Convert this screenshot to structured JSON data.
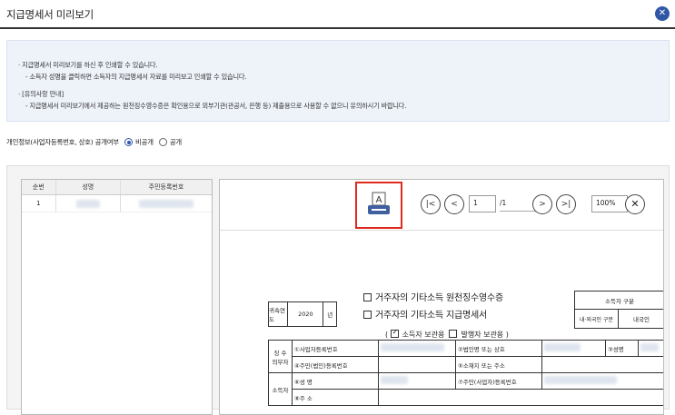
{
  "window": {
    "title": "지급명세서 미리보기"
  },
  "notice": {
    "line1": "· 지급명세서 미리보기를 하신 후 인쇄할 수 있습니다.",
    "line2": "- 소득자 성명을 클릭하면 소득자의 지급명세서 자료를 미리보고 인쇄할 수 있습니다.",
    "line3": "· [유의사항 안내]",
    "line4": "- 지급명세서 미리보기에서 제공하는 원천징수영수증은 확인용으로 외부기관(관공서, 은행 등) 제출용으로 사용할 수 없으니 유의하시기 바랍니다."
  },
  "privacy": {
    "label": "개인정보(사업자등록번호, 상호) 공개여부",
    "option_private": "비공개",
    "option_public": "공개",
    "selected": "비공개"
  },
  "list": {
    "headers": [
      "순번",
      "성명",
      "주민등록번호"
    ],
    "rows": [
      {
        "no": "1"
      }
    ]
  },
  "toolbar": {
    "first_icon": "first-page-icon",
    "prev_icon": "prev-page-icon",
    "page": "1",
    "total": "/1",
    "next_icon": "next-page-icon",
    "last_icon": "last-page-icon",
    "zoom": "100%",
    "zoom_reset_icon": "close-icon"
  },
  "form": {
    "title1": "거주자의 기타소득 원천징수영수증",
    "title2": "거주자의 기타소득 지급명세서",
    "year_label": "귀속연도",
    "year": "2020",
    "year_unit": "년",
    "earner_type_label": "소득자 구분",
    "domestic_foreign": "내·외국인 구분",
    "domestic": "내국인",
    "copy_open": "(",
    "copy_earner": "소득자 보관용",
    "copy_payer": "발행자 보관용",
    "copy_close": ")",
    "withholder_label": "징 수 의무자",
    "biz_no": "①사업자등록번호",
    "corp_name": "②법인명 또는 상호",
    "name3": "③성명",
    "resident_no": "④주민(법인)등록번호",
    "address5": "⑤소재지 또는 주소",
    "earner_label": "소득자",
    "name6": "⑥성 명",
    "resident7": "⑦주민(사업자)등록번호",
    "address8": "⑧주 소"
  }
}
